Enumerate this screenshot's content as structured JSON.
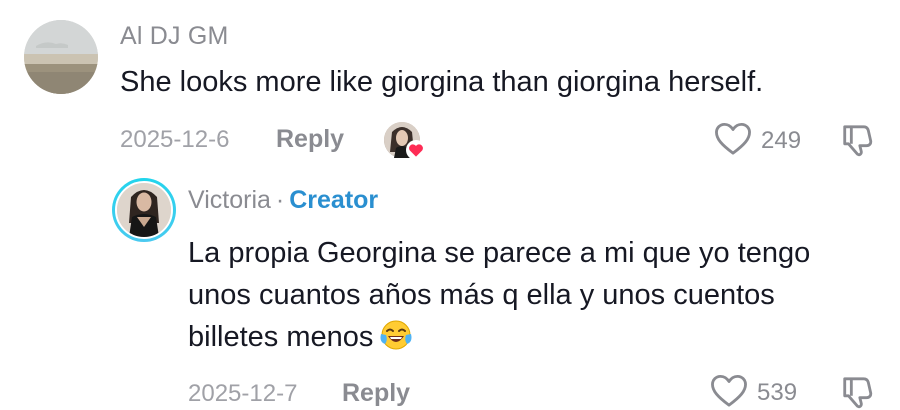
{
  "comment": {
    "username": "Al DJ GM",
    "text": "She looks more like giorgina than giorgina herself.",
    "date": "2025-12-6",
    "reply_label": "Reply",
    "likes": "249",
    "liked_by_creator": true
  },
  "reply": {
    "username": "Victoria",
    "separator": "·",
    "badge": "Creator",
    "text": "La propia Georgina se parece a mi que yo tengo unos cuantos años más q ella y unos cuentos billetes menos",
    "emoji": "face-with-tears-of-joy",
    "date": "2025-12-7",
    "reply_label": "Reply",
    "likes": "539"
  },
  "colors": {
    "primary_text": "#161823",
    "secondary_text": "#8a8b91",
    "creator_badge": "#2a8fd0",
    "like_heart": "#fe2c55",
    "avatar_ring": "#20d5ec"
  }
}
